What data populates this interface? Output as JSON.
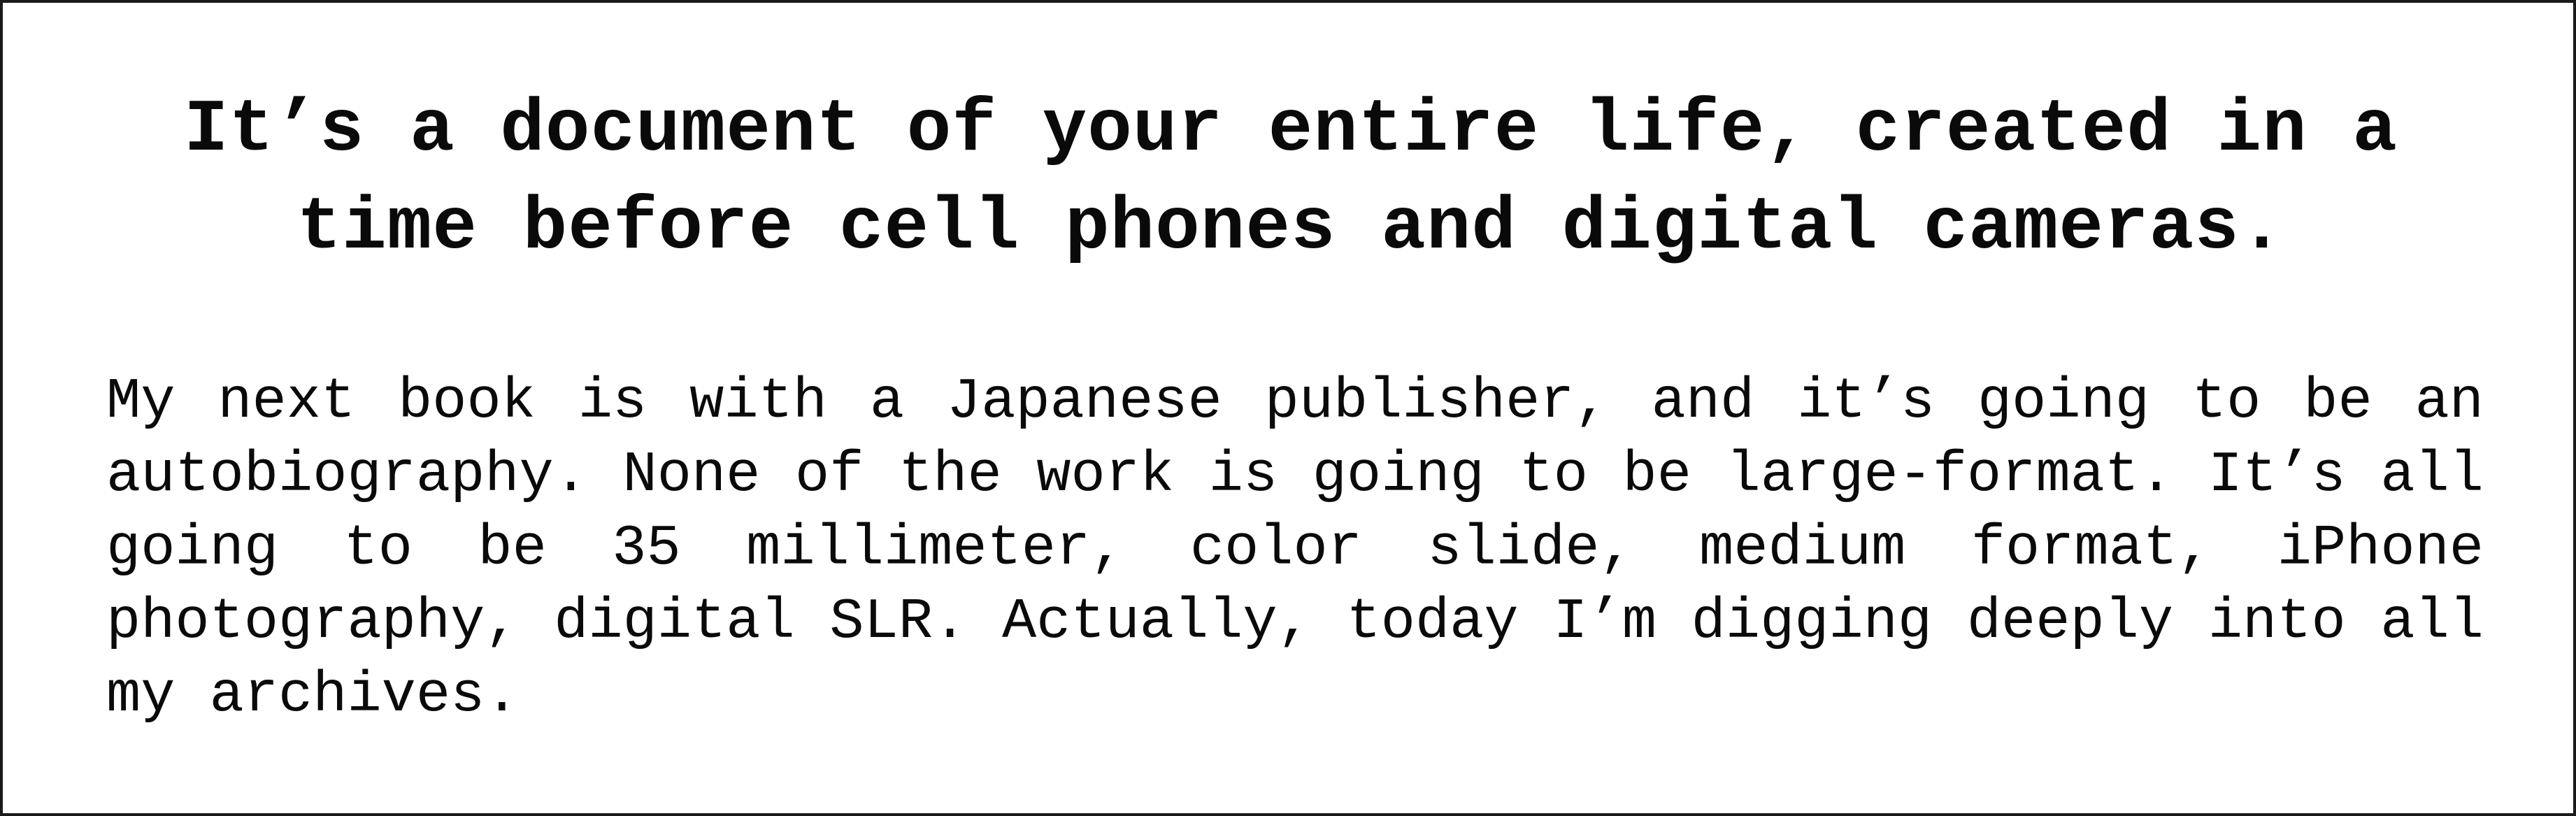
{
  "headline": "It’s a document of your entire life, created in a time before cell phones and digital cameras.",
  "body": "My next book is with a Japanese publisher, and it’s going to be an autobiography. None of the work is going to be large-format. It’s all going to be 35 millimeter, color slide, medium format, iPhone photography, digital SLR. Actually, today I’m digging deeply into all my archives."
}
